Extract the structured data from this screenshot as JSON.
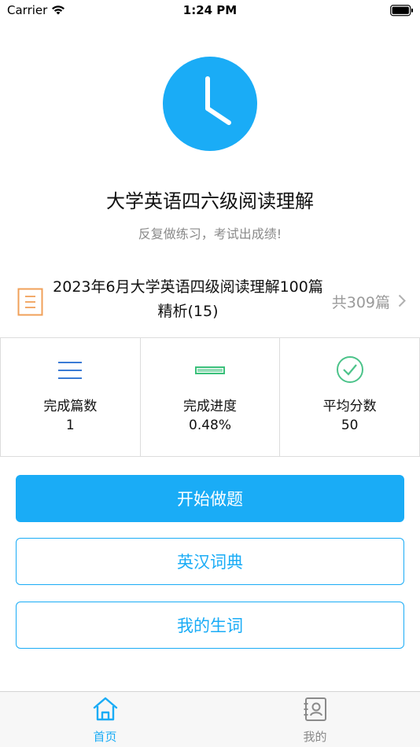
{
  "status_bar": {
    "carrier": "Carrier",
    "time": "1:24 PM"
  },
  "hero": {
    "icon": "clock-icon",
    "title": "大学英语四六级阅读理解",
    "subtitle": "反复做练习，考试出成绩!"
  },
  "book": {
    "icon": "document-icon",
    "title": "2023年6月大学英语四级阅读理解100篇精析(15)",
    "count": "共309篇"
  },
  "stats": [
    {
      "icon": "list-lines-icon",
      "label": "完成篇数",
      "value": "1"
    },
    {
      "icon": "progress-bar-icon",
      "label": "完成进度",
      "value": "0.48%",
      "progress": 0.0048
    },
    {
      "icon": "check-circle-icon",
      "label": "平均分数",
      "value": "50"
    }
  ],
  "buttons": {
    "start": "开始做题",
    "dictionary": "英汉词典",
    "my_words": "我的生词"
  },
  "tabs": [
    {
      "label": "首页",
      "icon": "home-icon",
      "active": true
    },
    {
      "label": "我的",
      "icon": "profile-book-icon",
      "active": false
    }
  ],
  "colors": {
    "accent": "#1aacf6",
    "book_icon": "#f0a05a",
    "stat_icon": "#3a7bd5",
    "progress_icon": "#3ac07a",
    "check_icon": "#4cc38a"
  }
}
